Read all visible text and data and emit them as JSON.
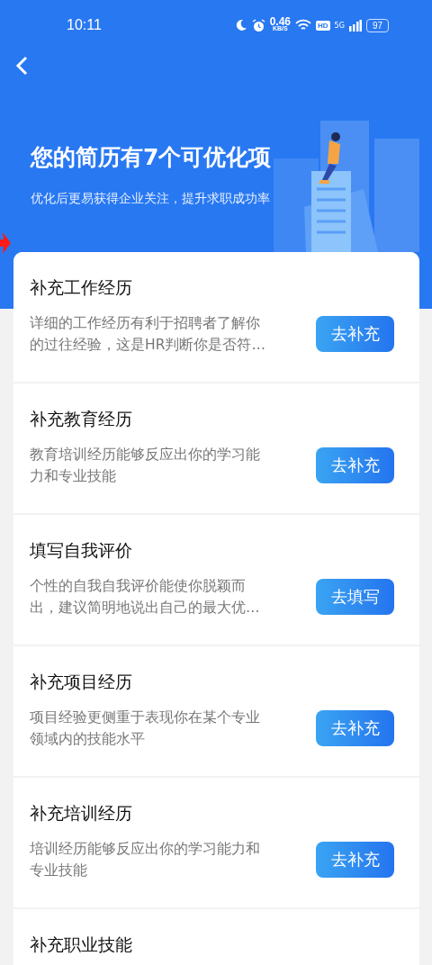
{
  "status_bar": {
    "time": "10:11",
    "speed": "0.46",
    "speed_unit": "KB/S",
    "hd": "HD",
    "network": "5G",
    "battery": "97"
  },
  "header": {
    "title": "您的简历有7个可优化项",
    "subtitle": "优化后更易获得企业关注，提升求职成功率"
  },
  "items": [
    {
      "title": "补充工作经历",
      "description": "详细的工作经历有利于招聘者了解你的过往经验，这是HR判断你是否符…",
      "button": "去补充"
    },
    {
      "title": "补充教育经历",
      "description": "教育培训经历能够反应出你的学习能力和专业技能",
      "button": "去补充"
    },
    {
      "title": "填写自我评价",
      "description": "个性的自我自我评价能使你脱颖而出，建议简明地说出自己的最大优…",
      "button": "去填写"
    },
    {
      "title": "补充项目经历",
      "description": "项目经验更侧重于表现你在某个专业领域内的技能水平",
      "button": "去补充"
    },
    {
      "title": "补充培训经历",
      "description": "培训经历能够反应出你的学习能力和专业技能",
      "button": "去补充"
    },
    {
      "title": "补充职业技能"
    }
  ]
}
